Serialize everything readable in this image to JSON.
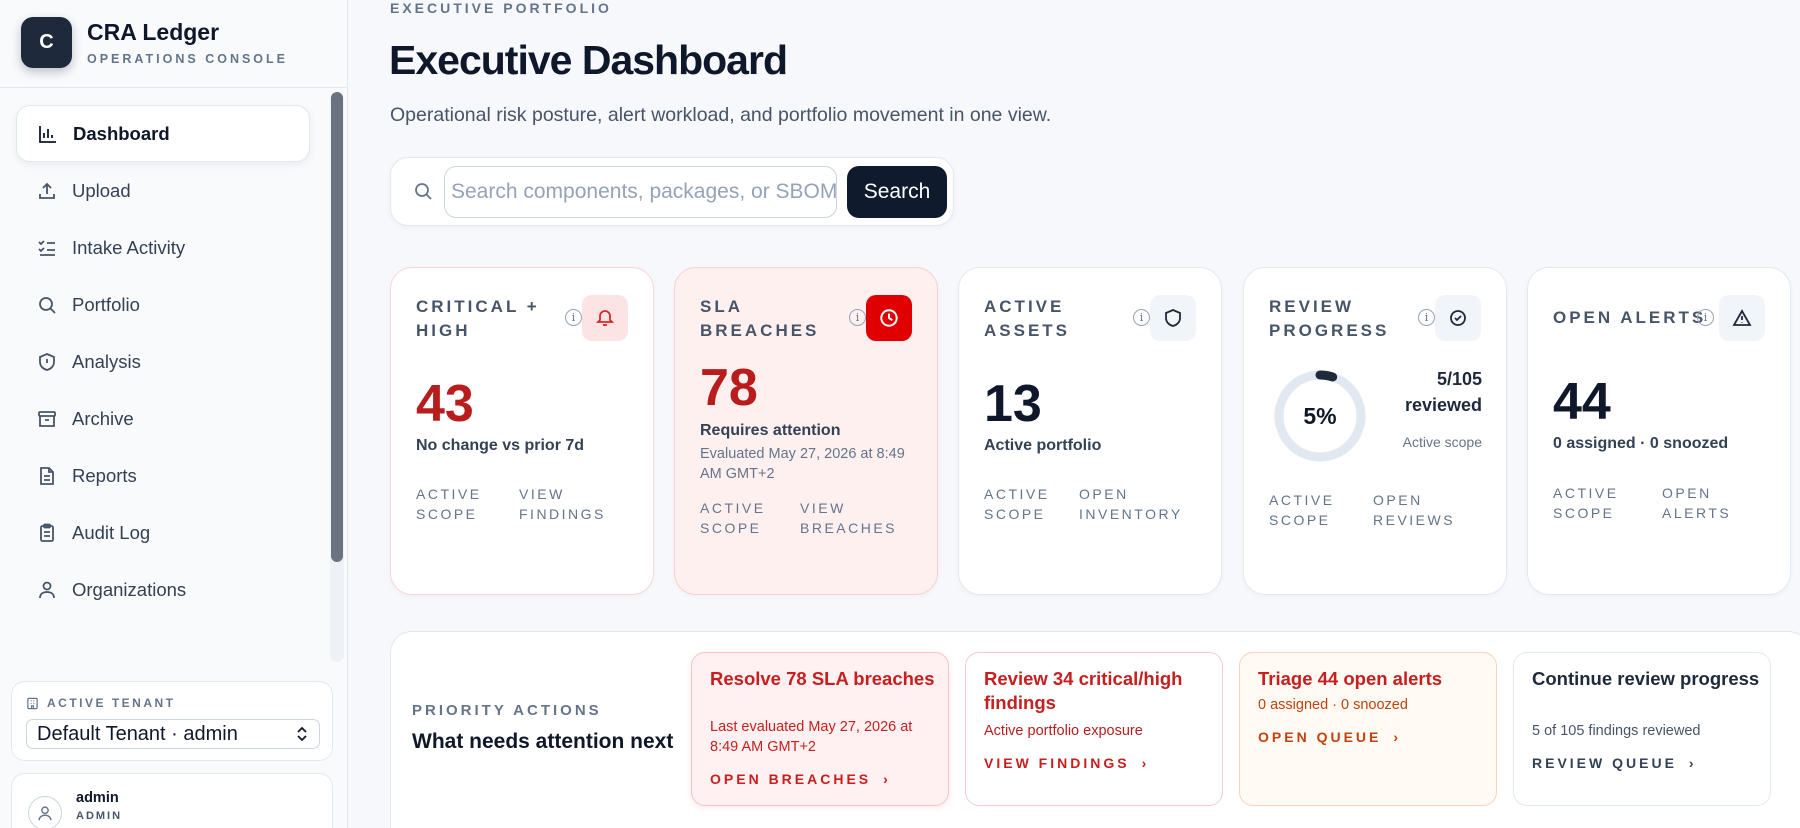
{
  "brand": {
    "initial": "C",
    "name": "CRA Ledger",
    "subtitle": "OPERATIONS CONSOLE"
  },
  "sidebar": {
    "items": [
      {
        "label": "Dashboard",
        "icon": "bar-chart-icon",
        "active": true
      },
      {
        "label": "Upload",
        "icon": "upload-icon"
      },
      {
        "label": "Intake Activity",
        "icon": "checklist-icon"
      },
      {
        "label": "Portfolio",
        "icon": "search-icon"
      },
      {
        "label": "Analysis",
        "icon": "shield-icon"
      },
      {
        "label": "Archive",
        "icon": "archive-icon"
      },
      {
        "label": "Reports",
        "icon": "document-icon"
      },
      {
        "label": "Audit Log",
        "icon": "clipboard-icon"
      },
      {
        "label": "Organizations",
        "icon": "user-icon"
      }
    ],
    "tenant": {
      "label": "ACTIVE TENANT",
      "value": "Default Tenant · admin"
    },
    "user": {
      "name": "admin",
      "role": "ADMIN"
    }
  },
  "header": {
    "kicker": "EXECUTIVE PORTFOLIO",
    "title": "Executive Dashboard",
    "subtitle": "Operational risk posture, alert workload, and portfolio movement in one view."
  },
  "search": {
    "placeholder": "Search components, packages, or SBOMs",
    "button": "Search"
  },
  "cards": {
    "critical": {
      "label": "CRITICAL + HIGH",
      "value": "43",
      "desc": "No change vs prior 7d",
      "link1": "ACTIVE SCOPE",
      "link2": "VIEW FINDINGS"
    },
    "sla": {
      "label": "SLA BREACHES",
      "value": "78",
      "desc": "Requires attention",
      "note": "Evaluated May 27, 2026 at 8:49 AM GMT+2",
      "link1": "ACTIVE SCOPE",
      "link2": "VIEW BREACHES"
    },
    "assets": {
      "label": "ACTIVE ASSETS",
      "value": "13",
      "desc": "Active portfolio",
      "link1": "ACTIVE SCOPE",
      "link2": "OPEN INVENTORY"
    },
    "review": {
      "label": "REVIEW PROGRESS",
      "percent_text": "5%",
      "percent": 0.05,
      "count": "5/105 reviewed",
      "scope": "Active scope",
      "link1": "ACTIVE SCOPE",
      "link2": "OPEN REVIEWS"
    },
    "alerts": {
      "label": "OPEN ALERTS",
      "value": "44",
      "desc": "0 assigned · 0 snoozed",
      "link1": "ACTIVE SCOPE",
      "link2": "OPEN ALERTS"
    }
  },
  "priority": {
    "kicker": "PRIORITY ACTIONS",
    "title": "What needs attention next",
    "actions": [
      {
        "title": "Resolve 78 SLA breaches",
        "sub": "Last evaluated May 27, 2026 at 8:49 AM GMT+2",
        "link": "OPEN BREACHES"
      },
      {
        "title": "Review 34 critical/high findings",
        "sub": "Active portfolio exposure",
        "link": "VIEW FINDINGS"
      },
      {
        "title": "Triage 44 open alerts",
        "sub": "0 assigned · 0 snoozed",
        "link": "OPEN QUEUE"
      },
      {
        "title": "Continue review progress",
        "sub": "5 of 105 findings reviewed",
        "link": "REVIEW QUEUE"
      }
    ]
  },
  "colors": {
    "accent": "#0f1b2d",
    "danger": "#dc2626",
    "danger_bg": "#fff0f0",
    "warn_bg": "#fffaf3"
  }
}
